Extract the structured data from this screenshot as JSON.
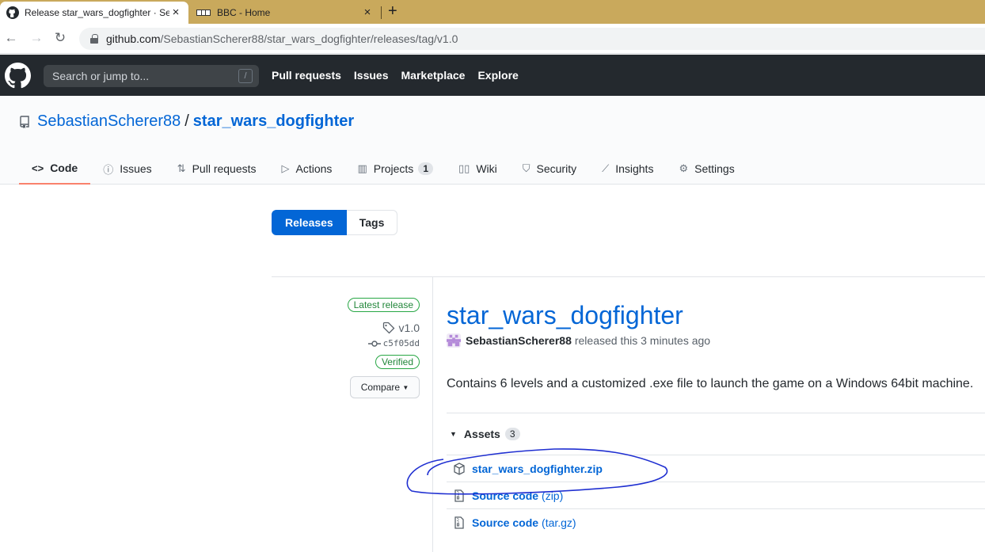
{
  "browser": {
    "tabs": [
      {
        "title": "Release star_wars_dogfighter · Se",
        "active": true
      },
      {
        "title": "BBC - Home",
        "active": false
      }
    ],
    "new_tab_glyph": "+",
    "close_glyph": "×",
    "url_host": "github.com",
    "url_path": "/SebastianScherer88/star_wars_dogfighter/releases/tag/v1.0"
  },
  "header": {
    "search_placeholder": "Search or jump to...",
    "search_shortcut": "/",
    "nav": [
      "Pull requests",
      "Issues",
      "Marketplace",
      "Explore"
    ]
  },
  "repo": {
    "owner": "SebastianScherer88",
    "separator": "/",
    "name": "star_wars_dogfighter",
    "tabs": [
      {
        "label": "Code",
        "icon": "code-icon"
      },
      {
        "label": "Issues",
        "icon": "issue-icon"
      },
      {
        "label": "Pull requests",
        "icon": "pull-request-icon"
      },
      {
        "label": "Actions",
        "icon": "play-icon"
      },
      {
        "label": "Projects",
        "icon": "project-icon",
        "counter": "1"
      },
      {
        "label": "Wiki",
        "icon": "book-icon"
      },
      {
        "label": "Security",
        "icon": "shield-icon"
      },
      {
        "label": "Insights",
        "icon": "graph-icon"
      },
      {
        "label": "Settings",
        "icon": "gear-icon"
      }
    ]
  },
  "subnav": {
    "releases": "Releases",
    "tags": "Tags"
  },
  "release": {
    "latest_label": "Latest release",
    "tag": "v1.0",
    "commit": "c5f05dd",
    "verified": "Verified",
    "compare": "Compare",
    "title": "star_wars_dogfighter",
    "author": "SebastianScherer88",
    "released_text": "released this 3 minutes ago",
    "body": "Contains 6 levels and a customized .exe file to launch the game on a Windows 64bit machine.",
    "assets_label": "Assets",
    "assets_count": "3",
    "assets": [
      {
        "name": "star_wars_dogfighter.zip",
        "ext": "",
        "icon": "package-icon"
      },
      {
        "name": "Source code",
        "ext": "(zip)",
        "icon": "file-zip-icon"
      },
      {
        "name": "Source code",
        "ext": "(tar.gz)",
        "icon": "file-zip-icon"
      }
    ]
  },
  "colors": {
    "accent": "#0366d6",
    "header_bg": "#24292e",
    "tab_strip": "#c9a95c",
    "verified": "#28a745",
    "tab_underline": "#f9826c",
    "annotation": "#1f2fd1"
  }
}
